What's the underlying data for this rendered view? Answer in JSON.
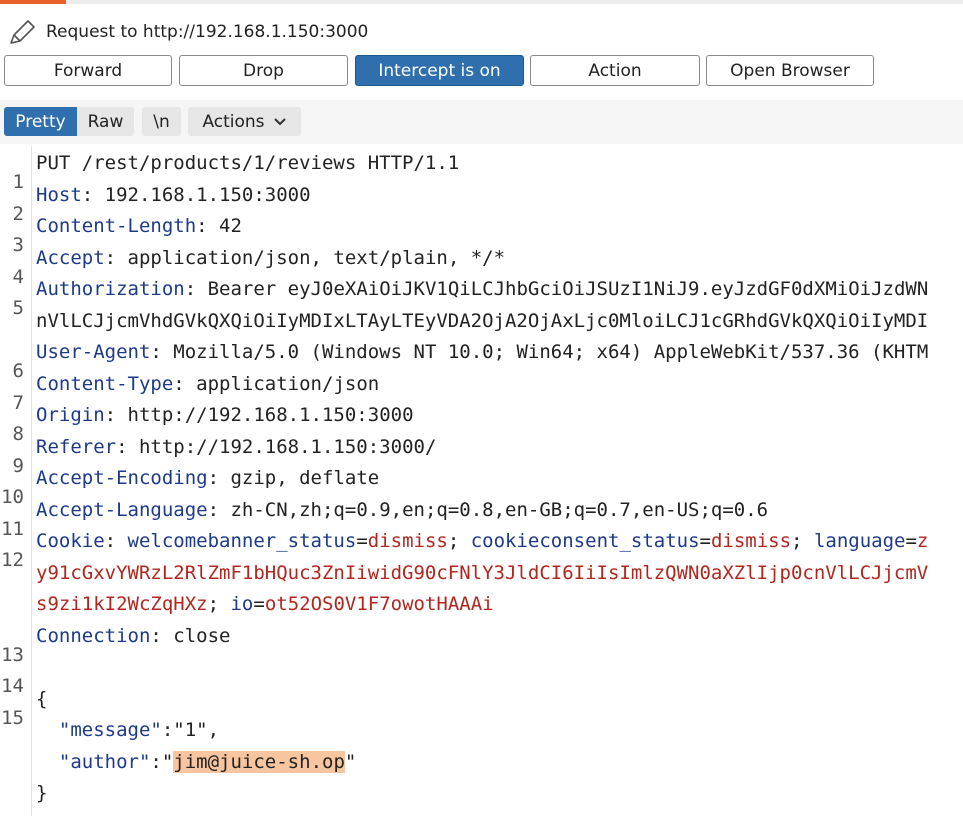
{
  "request": {
    "title": "Request to http://192.168.1.150:3000"
  },
  "toolbar": {
    "forward": "Forward",
    "drop": "Drop",
    "intercept": "Intercept is on",
    "action": "Action",
    "open_browser": "Open Browser"
  },
  "view_tabs": {
    "pretty": "Pretty",
    "raw": "Raw",
    "newline": "\\n",
    "actions": "Actions"
  },
  "colors": {
    "accent": "#e8612c",
    "active_button": "#2f6fad",
    "header_name": "#1d3a8a",
    "cookie_value": "#b3261e",
    "selection": "#f7c59f"
  },
  "editor": {
    "line_numbers": [
      "1",
      "2",
      "3",
      "4",
      "5",
      "6",
      "7",
      "8",
      "9",
      "10",
      "11",
      "12",
      "13",
      "14",
      "15"
    ],
    "request_line": "PUT /rest/products/1/reviews HTTP/1.1",
    "headers": [
      {
        "name": "Host",
        "value": "192.168.1.150:3000"
      },
      {
        "name": "Content-Length",
        "value": "42"
      },
      {
        "name": "Accept",
        "value": "application/json, text/plain, */*"
      },
      {
        "name": "Authorization",
        "value": "Bearer eyJ0eXAiOiJKV1QiLCJhbGciOiJSUzI1NiJ9.eyJzdGF0dXMiOiJzdWN",
        "cont": "nVlLCJjcmVhdGVkQXQiOiIyMDIxLTAyLTEyVDA2OjA2OjAxLjc0MloiLCJ1cGRhdGVkQXQiOiIyMDI"
      },
      {
        "name": "User-Agent",
        "value": "Mozilla/5.0 (Windows NT 10.0; Win64; x64) AppleWebKit/537.36 (KHTM"
      },
      {
        "name": "Content-Type",
        "value": "application/json"
      },
      {
        "name": "Origin",
        "value": "http://192.168.1.150:3000"
      },
      {
        "name": "Referer",
        "value": "http://192.168.1.150:3000/"
      },
      {
        "name": "Accept-Encoding",
        "value": "gzip, deflate"
      },
      {
        "name": "Accept-Language",
        "value": "zh-CN,zh;q=0.9,en;q=0.8,en-GB;q=0.7,en-US;q=0.6"
      }
    ],
    "cookie": {
      "name": "Cookie",
      "c1_name": "welcomebanner_status",
      "c1_value": "dismiss",
      "c2_name": "cookieconsent_status",
      "c2_value": "dismiss",
      "c3_name": "language",
      "c3_value_head": "z",
      "cont1": "y91cGxvYWRzL2RlZmF1bHQuc3ZnIiwidG90cFNlY3JldCI6IiIsImlzQWN0aXZlIjp0cnVlLCJjcmV",
      "cont2": "s9zi1kI2WcZqHXz",
      "c4_name": "io",
      "c4_value": "ot52OS0V1F7owotHAAAi"
    },
    "connection": {
      "name": "Connection",
      "value": "close"
    },
    "body": {
      "open": "{",
      "message_key": "\"message\"",
      "message_value": "\"1\"",
      "author_key": "\"author\"",
      "author_value": "jim@juice-sh.op",
      "close": "}"
    }
  }
}
